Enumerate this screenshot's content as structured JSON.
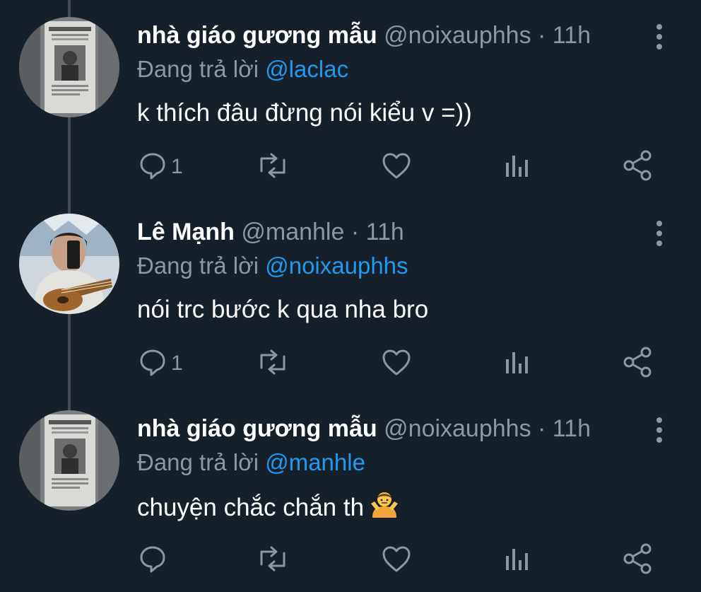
{
  "tweets": [
    {
      "name": "nhà giáo gương mẫu",
      "handle": "@noixauphhs",
      "sep_time": " · 11h",
      "reply_prefix": "Đang trả lời ",
      "reply_to": "@laclac",
      "text": "k thích đâu đừng nói kiểu v =))",
      "reply_count": "1",
      "avatar": "poster-photo"
    },
    {
      "name": "Lê Mạnh",
      "handle": "@manhle",
      "sep_time": " · 11h",
      "reply_prefix": "Đang trả lời ",
      "reply_to": "@noixauphhs",
      "text": "nói trc bước k qua nha bro",
      "reply_count": "1",
      "avatar": "guitar-photo"
    },
    {
      "name": "nhà giáo gương mẫu",
      "handle": "@noixauphhs",
      "sep_time": " · 11h",
      "reply_prefix": "Đang trả lời ",
      "reply_to": "@manhle",
      "text": "chuyện chắc chắn th",
      "reply_count": "",
      "emoji": "person-shrugging",
      "avatar": "poster-photo"
    }
  ],
  "colors": {
    "background": "#16202b",
    "text": "#ffffff",
    "muted": "#8d98a5",
    "link": "#1d9bf0",
    "thread_line": "#424b55"
  },
  "icons": [
    "reply-icon",
    "retweet-icon",
    "like-icon",
    "analytics-icon",
    "share-icon",
    "more-icon"
  ]
}
